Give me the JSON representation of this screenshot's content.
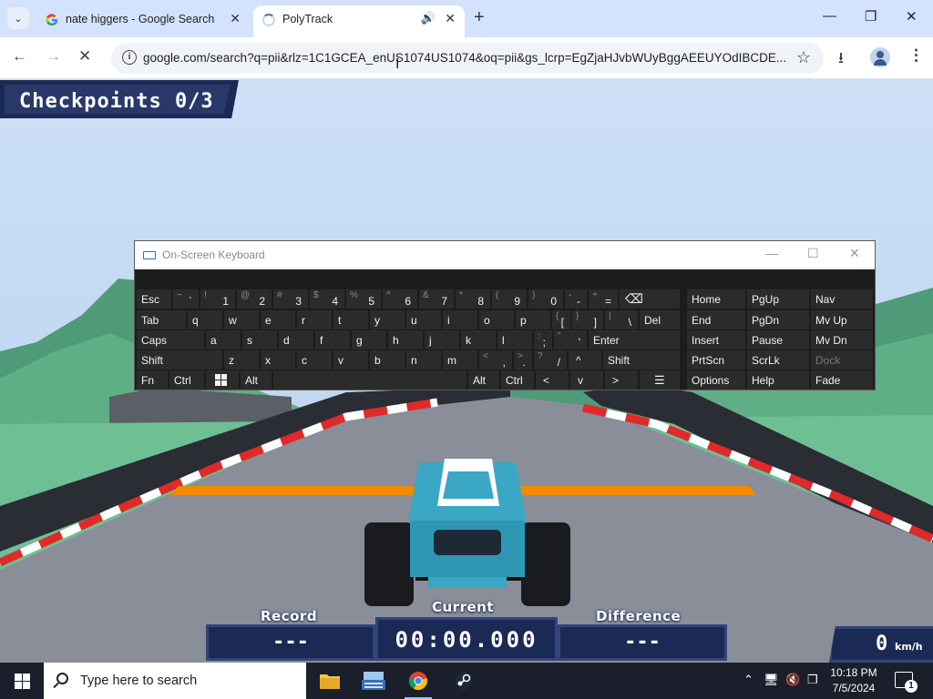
{
  "browser": {
    "tabs": [
      {
        "title": "nate higgers - Google Search"
      },
      {
        "title": "PolyTrack"
      }
    ],
    "url": "google.com/search?q=pii&rlz=1C1GCEA_enUS1074US1074&oq=pii&gs_lcrp=EgZjaHJvbWUyBggAEEUYOdIBCDE..."
  },
  "game": {
    "checkpoints": "Checkpoints 0/3",
    "record_label": "Record",
    "record_value": "---",
    "current_label": "Current",
    "current_value": "00:00.000",
    "difference_label": "Difference",
    "difference_value": "---",
    "speed_value": "0",
    "speed_unit": "km/h",
    "colors": {
      "hud_bg": "#1a2a55",
      "track_red": "#e02a2a",
      "track_orange": "#f08a00",
      "car": "#3aa7c4"
    }
  },
  "osk": {
    "title": "On-Screen Keyboard",
    "nav": {
      "home": "Home",
      "pgup": "PgUp",
      "nav": "Nav",
      "end": "End",
      "pgdn": "PgDn",
      "mvup": "Mv Up",
      "insert": "Insert",
      "pause": "Pause",
      "mvdn": "Mv Dn",
      "prtscn": "PrtScn",
      "scrlk": "ScrLk",
      "dock": "Dock",
      "options": "Options",
      "help": "Help",
      "fade": "Fade"
    },
    "keys": {
      "esc": "Esc",
      "tab": "Tab",
      "caps": "Caps",
      "shift": "Shift",
      "fn": "Fn",
      "ctrl": "Ctrl",
      "alt": "Alt",
      "del": "Del",
      "enter": "Enter",
      "shift_r": "Shift",
      "alt_r": "Alt",
      "ctrl_r": "Ctrl",
      "n1": "1",
      "s1": "!",
      "n2": "2",
      "s2": "@",
      "n3": "3",
      "s3": "#",
      "n4": "4",
      "s4": "$",
      "n5": "5",
      "s5": "%",
      "n6": "6",
      "s6": "^",
      "n7": "7",
      "s7": "&",
      "n8": "8",
      "s8": "*",
      "n9": "9",
      "s9": "(",
      "n0": "0",
      "s0": ")",
      "tilde_s": "~",
      "tilde_m": "`",
      "minus_s": "-",
      "minus_m": "-",
      "plus_s": "+",
      "plus_m": "=",
      "q": "q",
      "w": "w",
      "e": "e",
      "r": "r",
      "t": "t",
      "y": "y",
      "u": "u",
      "i": "i",
      "o": "o",
      "p": "p",
      "lb_s": "{",
      "lb_m": "[",
      "rb_s": "}",
      "rb_m": "]",
      "bs_s": "|",
      "bs_m": "\\",
      "a": "a",
      "s": "s",
      "d": "d",
      "f": "f",
      "g": "g",
      "h": "h",
      "j": "j",
      "k": "k",
      "l": "l",
      "semi_s": ":",
      "semi_m": ";",
      "quote_s": "\"",
      "quote_m": "'",
      "z": "z",
      "x": "x",
      "c": "c",
      "v": "v",
      "b": "b",
      "n": "n",
      "m": "m",
      "comma_s": "<",
      "comma_m": ",",
      "dot_s": ">",
      "dot_m": ".",
      "slash_s": "?",
      "slash_m": "/",
      "up": "^",
      "left": "<",
      "down": "v",
      "right": ">"
    }
  },
  "taskbar": {
    "search_placeholder": "Type here to search",
    "time": "10:18 PM",
    "date": "7/5/2024",
    "notifications": "1"
  }
}
